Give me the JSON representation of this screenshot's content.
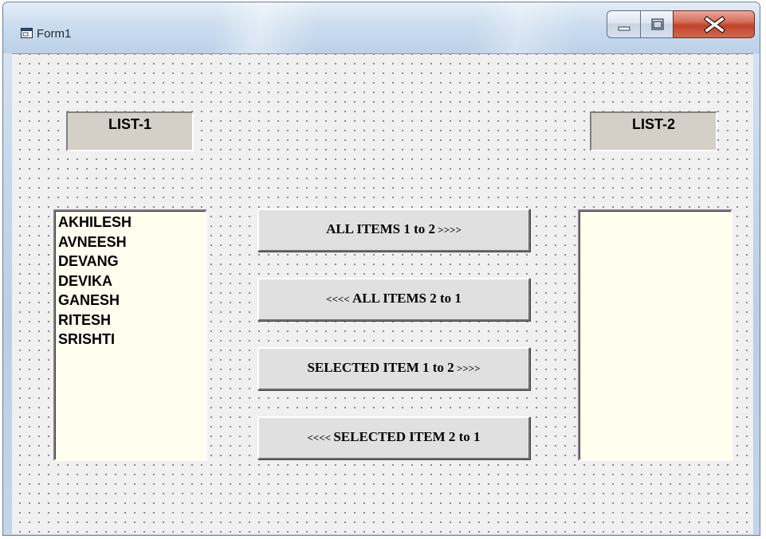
{
  "window": {
    "title": "Form1"
  },
  "labels": {
    "list1": "LIST-1",
    "list2": "LIST-2"
  },
  "list1": {
    "items": [
      "AKHILESH",
      "AVNEESH",
      "DEVANG",
      "DEVIKA",
      "GANESH",
      "RITESH",
      "SRISHTI"
    ]
  },
  "list2": {
    "items": []
  },
  "buttons": {
    "all_1_to_2": {
      "prefix": "",
      "text": "ALL ITEMS  1 to 2",
      "suffix": " >>>>"
    },
    "all_2_to_1": {
      "prefix": "<<<<  ",
      "text": "ALL ITEMS  2 to 1",
      "suffix": ""
    },
    "sel_1_to_2": {
      "prefix": "",
      "text": "SELECTED ITEM  1 to 2",
      "suffix": " >>>>"
    },
    "sel_2_to_1": {
      "prefix": "<<<< ",
      "text": "SELECTED ITEM  2 to 1",
      "suffix": ""
    }
  },
  "colors": {
    "listbox_bg": "#ffffef",
    "label_bg": "#d4d0c8",
    "form_bg": "#f0f0f0",
    "close_button": "#c0422a"
  },
  "icons": {
    "app": "form-window-icon",
    "minimize": "minimize-icon",
    "maximize": "maximize-icon",
    "close": "close-icon"
  }
}
